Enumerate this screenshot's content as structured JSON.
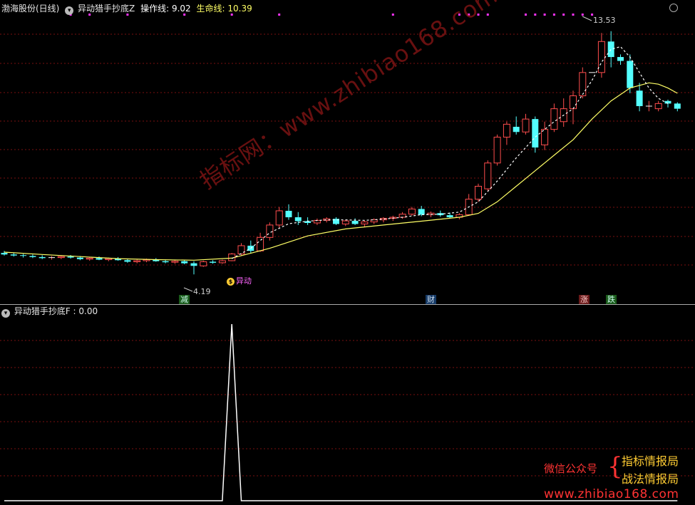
{
  "header": {
    "stock_label": "渤海股份(日线)",
    "indicator_name": "异动猎手抄底Z",
    "op_label": "操作线: 9.02",
    "life_label": "生命线: 10.39"
  },
  "sub_header": {
    "indicator_label": "异动猎手抄底F : 0.00"
  },
  "annotations": {
    "high_label": "13.53",
    "low_label": "4.19",
    "signal_label": "异动",
    "signal_icon": "$"
  },
  "badges": [
    {
      "text": "减",
      "color": "#2ecc40"
    },
    {
      "text": "财",
      "color": "#4aa3ff"
    },
    {
      "text": "涨",
      "color": "#ff4d4d"
    },
    {
      "text": "跌",
      "color": "#2ecc40"
    }
  ],
  "watermark": "指标网：www.zhibiao168.com",
  "promo": {
    "wechat": "微信公众号",
    "brace": "{",
    "line1": "指标情报局",
    "line2": "战法情报局",
    "url": "www.zhibiao168.com"
  },
  "colors": {
    "up": "#ff4d4d",
    "down": "#54ffff",
    "ma": "#ffff66",
    "op_line": "#ffffff",
    "grid": "#7a1010",
    "dots": "#ff33ff"
  },
  "chart_data": [
    {
      "type": "candlestick",
      "title": "渤海股份(日线)",
      "ylim": [
        3.7,
        14.2
      ],
      "candles": [
        [
          5.02,
          5.1,
          4.92,
          4.96
        ],
        [
          4.96,
          5.02,
          4.88,
          4.92
        ],
        [
          4.92,
          4.98,
          4.84,
          4.9
        ],
        [
          4.9,
          4.96,
          4.82,
          4.86
        ],
        [
          4.86,
          4.93,
          4.78,
          4.82
        ],
        [
          4.82,
          4.9,
          4.76,
          4.84
        ],
        [
          4.84,
          4.92,
          4.78,
          4.88
        ],
        [
          4.88,
          4.94,
          4.8,
          4.84
        ],
        [
          4.84,
          4.9,
          4.74,
          4.78
        ],
        [
          4.78,
          4.86,
          4.72,
          4.82
        ],
        [
          4.82,
          4.88,
          4.74,
          4.76
        ],
        [
          4.76,
          4.84,
          4.7,
          4.8
        ],
        [
          4.8,
          4.86,
          4.72,
          4.74
        ],
        [
          4.74,
          4.8,
          4.64,
          4.68
        ],
        [
          4.68,
          4.76,
          4.62,
          4.72
        ],
        [
          4.72,
          4.8,
          4.66,
          4.76
        ],
        [
          4.76,
          4.82,
          4.68,
          4.7
        ],
        [
          4.7,
          4.76,
          4.62,
          4.66
        ],
        [
          4.66,
          4.74,
          4.6,
          4.7
        ],
        [
          4.7,
          4.76,
          4.58,
          4.62
        ],
        [
          4.62,
          4.7,
          4.19,
          4.52
        ],
        [
          4.52,
          4.72,
          4.48,
          4.68
        ],
        [
          4.68,
          4.74,
          4.6,
          4.64
        ],
        [
          4.64,
          4.76,
          4.6,
          4.72
        ],
        [
          4.72,
          5.02,
          4.7,
          4.98
        ],
        [
          4.98,
          5.4,
          4.92,
          5.3
        ],
        [
          5.3,
          5.5,
          5.0,
          5.1
        ],
        [
          5.1,
          5.8,
          5.06,
          5.62
        ],
        [
          5.62,
          6.2,
          5.5,
          6.1
        ],
        [
          6.1,
          6.8,
          6.0,
          6.65
        ],
        [
          6.65,
          6.9,
          6.3,
          6.4
        ],
        [
          6.4,
          6.6,
          6.1,
          6.25
        ],
        [
          6.25,
          6.4,
          6.1,
          6.18
        ],
        [
          6.18,
          6.35,
          6.1,
          6.28
        ],
        [
          6.28,
          6.4,
          6.2,
          6.34
        ],
        [
          6.34,
          6.4,
          6.1,
          6.14
        ],
        [
          6.14,
          6.3,
          6.06,
          6.26
        ],
        [
          6.26,
          6.36,
          6.1,
          6.14
        ],
        [
          6.14,
          6.28,
          6.04,
          6.22
        ],
        [
          6.22,
          6.36,
          6.14,
          6.3
        ],
        [
          6.3,
          6.4,
          6.2,
          6.36
        ],
        [
          6.36,
          6.46,
          6.26,
          6.4
        ],
        [
          6.4,
          6.6,
          6.34,
          6.52
        ],
        [
          6.52,
          6.8,
          6.46,
          6.72
        ],
        [
          6.72,
          6.84,
          6.44,
          6.5
        ],
        [
          6.5,
          6.62,
          6.4,
          6.56
        ],
        [
          6.56,
          6.66,
          6.42,
          6.48
        ],
        [
          6.48,
          6.58,
          6.36,
          6.4
        ],
        [
          6.4,
          6.56,
          6.32,
          6.5
        ],
        [
          6.5,
          7.3,
          6.46,
          7.1
        ],
        [
          7.1,
          7.7,
          7.0,
          7.6
        ],
        [
          7.5,
          8.6,
          7.4,
          8.5
        ],
        [
          8.5,
          9.6,
          8.4,
          9.5
        ],
        [
          9.5,
          10.1,
          9.2,
          10.0
        ],
        [
          9.9,
          10.3,
          9.6,
          9.7
        ],
        [
          9.7,
          10.4,
          9.6,
          10.2
        ],
        [
          10.2,
          10.3,
          8.9,
          9.1
        ],
        [
          9.2,
          10.1,
          9.0,
          9.8
        ],
        [
          9.8,
          10.8,
          9.7,
          10.6
        ],
        [
          10.1,
          11.0,
          9.9,
          10.6
        ],
        [
          10.6,
          11.3,
          10.0,
          11.1
        ],
        [
          11.1,
          12.2,
          11.0,
          12.0
        ],
        [
          12.0,
          12.0,
          12.0,
          12.0
        ],
        [
          12.0,
          13.53,
          11.8,
          13.2
        ],
        [
          13.2,
          13.6,
          12.2,
          12.6
        ],
        [
          12.6,
          12.7,
          12.3,
          12.45
        ],
        [
          12.45,
          12.7,
          11.2,
          11.4
        ],
        [
          11.3,
          11.6,
          10.5,
          10.7
        ],
        [
          10.7,
          10.9,
          10.5,
          10.7
        ],
        [
          10.6,
          10.9,
          10.5,
          10.8
        ],
        [
          10.9,
          10.95,
          10.65,
          10.8
        ],
        [
          10.8,
          10.85,
          10.5,
          10.6
        ]
      ],
      "op_line": [
        [
          24,
          4.8
        ],
        [
          26,
          5.2
        ],
        [
          28,
          5.8
        ],
        [
          30,
          6.15
        ],
        [
          32,
          6.25
        ],
        [
          34,
          6.3
        ],
        [
          36,
          6.3
        ],
        [
          38,
          6.28
        ],
        [
          40,
          6.33
        ],
        [
          42,
          6.4
        ],
        [
          44,
          6.5
        ],
        [
          46,
          6.52
        ],
        [
          48,
          6.6
        ],
        [
          50,
          7.0
        ],
        [
          52,
          7.8
        ],
        [
          54,
          8.7
        ],
        [
          56,
          9.5
        ],
        [
          58,
          10.1
        ],
        [
          60,
          10.6
        ],
        [
          62,
          11.7
        ],
        [
          63,
          12.4
        ],
        [
          64,
          12.9
        ],
        [
          65,
          13.0
        ],
        [
          66,
          12.6
        ],
        [
          67,
          12.0
        ],
        [
          68,
          11.4
        ],
        [
          69,
          11.0
        ],
        [
          70,
          10.8
        ]
      ],
      "ma_line": [
        [
          0,
          5.05
        ],
        [
          4,
          4.96
        ],
        [
          8,
          4.88
        ],
        [
          12,
          4.8
        ],
        [
          16,
          4.76
        ],
        [
          20,
          4.74
        ],
        [
          24,
          4.82
        ],
        [
          28,
          5.2
        ],
        [
          32,
          5.68
        ],
        [
          36,
          5.95
        ],
        [
          40,
          6.1
        ],
        [
          44,
          6.25
        ],
        [
          48,
          6.4
        ],
        [
          50,
          6.55
        ],
        [
          52,
          7.0
        ],
        [
          54,
          7.6
        ],
        [
          56,
          8.2
        ],
        [
          58,
          8.8
        ],
        [
          60,
          9.4
        ],
        [
          62,
          10.2
        ],
        [
          64,
          10.9
        ],
        [
          66,
          11.4
        ],
        [
          68,
          11.6
        ],
        [
          69,
          11.55
        ],
        [
          70,
          11.4
        ],
        [
          71,
          11.2
        ]
      ],
      "signal_dots_top": [
        7,
        9,
        13,
        19,
        24,
        29,
        41,
        48,
        49,
        50,
        51,
        55,
        56,
        57,
        58,
        59,
        60,
        61,
        62
      ]
    },
    {
      "type": "line",
      "title": "异动猎手抄底F",
      "ylim": [
        0,
        1
      ],
      "values": [
        0,
        0,
        0,
        0,
        0,
        0,
        0,
        0,
        0,
        0,
        0,
        0,
        0,
        0,
        0,
        0,
        0,
        0,
        0,
        0,
        0,
        0,
        0,
        0,
        1,
        0,
        0,
        0,
        0,
        0,
        0,
        0,
        0,
        0,
        0,
        0,
        0,
        0,
        0,
        0,
        0,
        0,
        0,
        0,
        0,
        0,
        0,
        0,
        0,
        0,
        0,
        0,
        0,
        0,
        0,
        0,
        0,
        0,
        0,
        0,
        0,
        0,
        0,
        0,
        0,
        0,
        0,
        0,
        0,
        0,
        0,
        0
      ]
    }
  ]
}
